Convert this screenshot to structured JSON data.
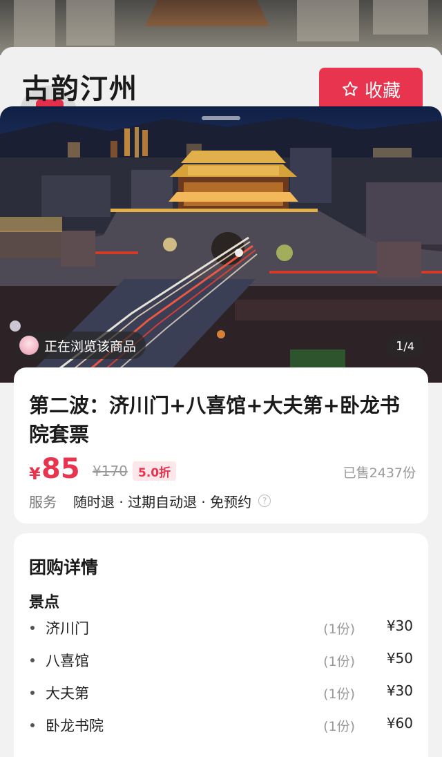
{
  "header": {
    "title": "古韵汀州",
    "favorite_label": "收藏",
    "favorite_icon": "star-icon"
  },
  "gallery": {
    "browsing_text": "正在浏览该商品",
    "counter_current": "1",
    "counter_total": "/4"
  },
  "product": {
    "title": "第二波：济川门+八喜馆+大夫第+卧龙书院套票",
    "currency": "¥",
    "price": "85",
    "original_price": "¥170",
    "discount": "5.0折",
    "sold": "已售2437份",
    "service_label": "服务",
    "service_items": "随时退 · 过期自动退 · 免预约",
    "accent_color": "#e8344e"
  },
  "details": {
    "title": "团购详情",
    "section": "景点",
    "items": [
      {
        "name": "济川门",
        "qty": "(1份)",
        "price": "¥30"
      },
      {
        "name": "八喜馆",
        "qty": "(1份)",
        "price": "¥50"
      },
      {
        "name": "大夫第",
        "qty": "(1份)",
        "price": "¥30"
      },
      {
        "name": "卧龙书院",
        "qty": "(1份)",
        "price": "¥60"
      }
    ]
  }
}
